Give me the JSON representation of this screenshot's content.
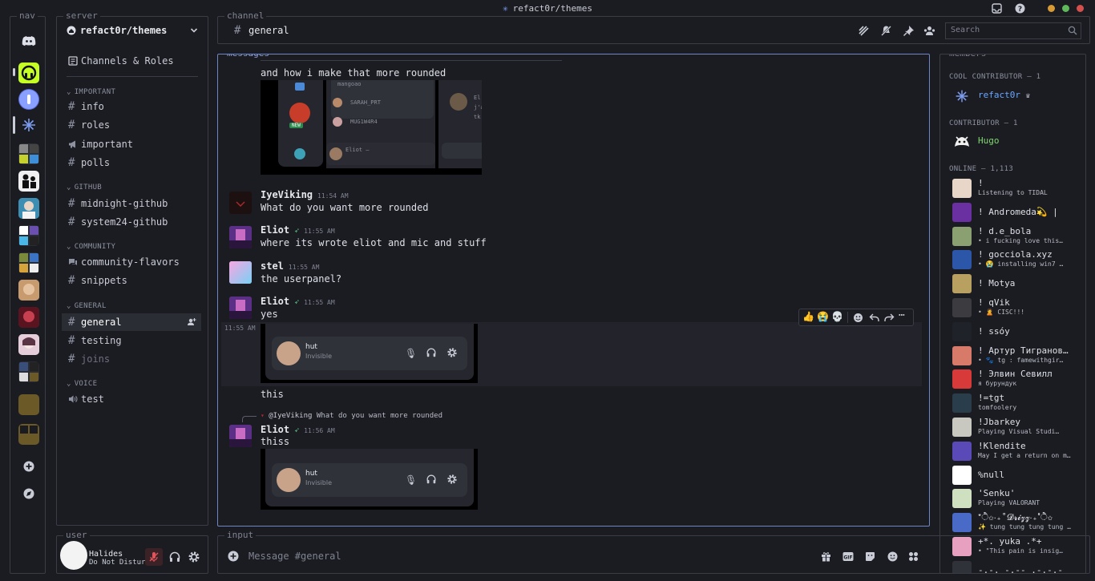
{
  "titlebar": {
    "title": "refact0r/themes"
  },
  "nav": {
    "legend": "nav"
  },
  "server": {
    "legend": "server",
    "name": "refact0r/themes",
    "channels_roles": "Channels & Roles",
    "categories": [
      {
        "name": "IMPORTANT",
        "channels": [
          {
            "label": "info",
            "icon": "hash"
          },
          {
            "label": "roles",
            "icon": "hash"
          },
          {
            "label": "important",
            "icon": "megaphone"
          },
          {
            "label": "polls",
            "icon": "hash"
          }
        ]
      },
      {
        "name": "GITHUB",
        "channels": [
          {
            "label": "midnight-github",
            "icon": "hash"
          },
          {
            "label": "system24-github",
            "icon": "hash"
          }
        ]
      },
      {
        "name": "COMMUNITY",
        "channels": [
          {
            "label": "community-flavors",
            "icon": "forum"
          },
          {
            "label": "snippets",
            "icon": "hash"
          }
        ]
      },
      {
        "name": "GENERAL",
        "channels": [
          {
            "label": "general",
            "icon": "hash"
          },
          {
            "label": "testing",
            "icon": "hash"
          },
          {
            "label": "joins",
            "icon": "hash"
          }
        ]
      },
      {
        "name": "VOICE",
        "channels": [
          {
            "label": "test",
            "icon": "speaker"
          }
        ]
      }
    ]
  },
  "channel": {
    "legend": "channel",
    "name": "general",
    "search_placeholder": "Search"
  },
  "messages": {
    "legend": "messages",
    "m0_text": "and how i make that more rounded",
    "img1": {
      "rows": [
        "mangoao",
        "SARAH_PRT",
        "MUG1W4R4"
      ],
      "new_badge": "NEW",
      "footer_name": "Eliot –",
      "side_text": [
        "El",
        "j'a",
        "tk"
      ]
    },
    "m1": {
      "author": "IyeViking",
      "time": "11:54 AM",
      "text": "What do you want more rounded"
    },
    "m2": {
      "author": "Eliot",
      "time": "11:55 AM",
      "text": "where its wrote eliot and mic and stuff"
    },
    "m3": {
      "author": "stel",
      "time": "11:55 AM",
      "text": "the userpanel?"
    },
    "m4": {
      "author": "Eliot",
      "time": "11:55 AM",
      "text": "yes"
    },
    "hover_time": "11:55 AM",
    "img2": {
      "name": "hut",
      "status": "Invisible"
    },
    "m5_text": "this",
    "reply": {
      "author": "@IyeViking",
      "text": "What do you want more rounded"
    },
    "m6": {
      "author": "Eliot",
      "time": "11:56 AM",
      "text": "thiss"
    },
    "img3": {
      "name": "hut",
      "status": "Invisible"
    }
  },
  "members": {
    "legend": "members",
    "cat1": "COOL CONTRIBUTOR — 1",
    "cat2": "CONTRIBUTOR — 1",
    "cat3": "ONLINE — 1,113",
    "cool": {
      "name": "refact0r"
    },
    "contrib": {
      "name": "Hugo"
    },
    "online": [
      {
        "name": "!",
        "status": "Listening to TIDAL"
      },
      {
        "name": "! Andromeda💫 |",
        "status": ""
      },
      {
        "name": "! d.e_bola",
        "status": "• i fucking love this…"
      },
      {
        "name": "! gocciola.xyz",
        "status": "• 😭 installing win7 …"
      },
      {
        "name": "! Motya",
        "status": ""
      },
      {
        "name": "! qVik",
        "status": "• 🙎 CISC!!!"
      },
      {
        "name": "! ssóy",
        "status": ""
      },
      {
        "name": "! Артур Тигранов…",
        "status": "• 🐾 tg : famewithgir…"
      },
      {
        "name": "! Элвин Севилл",
        "status": "я бурундук"
      },
      {
        "name": "!=tgt",
        "status": "tomfoolery"
      },
      {
        "name": "!Jbarkey",
        "status": "Playing Visual Studi…"
      },
      {
        "name": "!Klendite",
        "status": "May I get a return on m…"
      },
      {
        "name": "%null",
        "status": ""
      },
      {
        "name": "'Senku'",
        "status": "Playing VALORANT"
      },
      {
        "name": "*ੈ✩‧₊˚𝓓𝓻𝓲𝔃𝔃‧₊˚ੈ✩",
        "status": "✨ tung tung tung tung …"
      },
      {
        "name": "+*. yuka .*+",
        "status": "• \"This pain is insig…"
      },
      {
        "name": "-.-. -.-- .-.-.-",
        "status": ""
      }
    ]
  },
  "input": {
    "legend": "input",
    "placeholder": "Message #general"
  },
  "user": {
    "legend": "user",
    "name": "Halides",
    "status": "Do Not Disturb"
  },
  "colors": {
    "accent": "#6f86c4",
    "nav_green": "#c5ff24",
    "contributor_green": "#7fd76f",
    "name_blue": "#6aa6ff"
  }
}
